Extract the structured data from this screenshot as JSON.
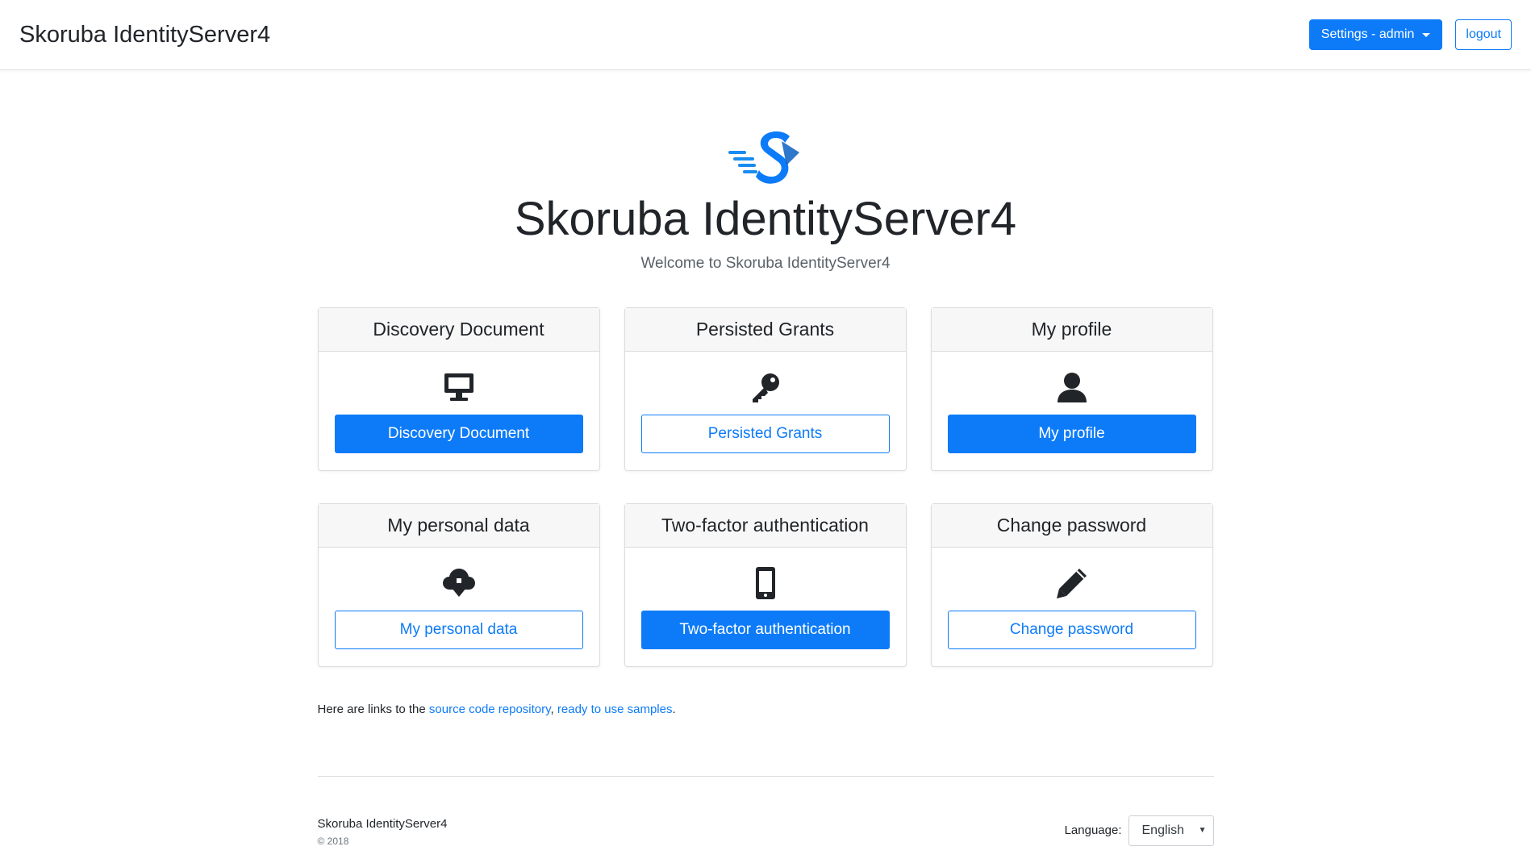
{
  "navbar": {
    "brand": "Skoruba IdentityServer4",
    "settings_label": "Settings - admin",
    "logout_label": "logout"
  },
  "hero": {
    "title": "Skoruba IdentityServer4",
    "subtitle": "Welcome to Skoruba IdentityServer4",
    "logo_icon": "skoruba-logo-icon"
  },
  "cards": [
    {
      "header": "Discovery Document",
      "button": "Discovery Document",
      "icon": "monitor-icon",
      "style": "primary"
    },
    {
      "header": "Persisted Grants",
      "button": "Persisted Grants",
      "icon": "key-icon",
      "style": "outline"
    },
    {
      "header": "My profile",
      "button": "My profile",
      "icon": "user-icon",
      "style": "primary"
    },
    {
      "header": "My personal data",
      "button": "My personal data",
      "icon": "cloud-download-icon",
      "style": "outline"
    },
    {
      "header": "Two-factor authentication",
      "button": "Two-factor authentication",
      "icon": "mobile-phone-icon",
      "style": "primary"
    },
    {
      "header": "Change password",
      "button": "Change password",
      "icon": "pencil-icon",
      "style": "outline"
    }
  ],
  "links": {
    "prefix": "Here are links to the",
    "source_code": "source code repository",
    "comma": ",",
    "samples": "ready to use samples",
    "suffix": "."
  },
  "footer": {
    "brand": "Skoruba IdentityServer4",
    "copyright": "© 2018",
    "language_label": "Language:",
    "language_value": "English"
  },
  "colors": {
    "accent": "#0d7bf8",
    "text": "#212529",
    "card_header_bg": "#f7f7f7"
  }
}
